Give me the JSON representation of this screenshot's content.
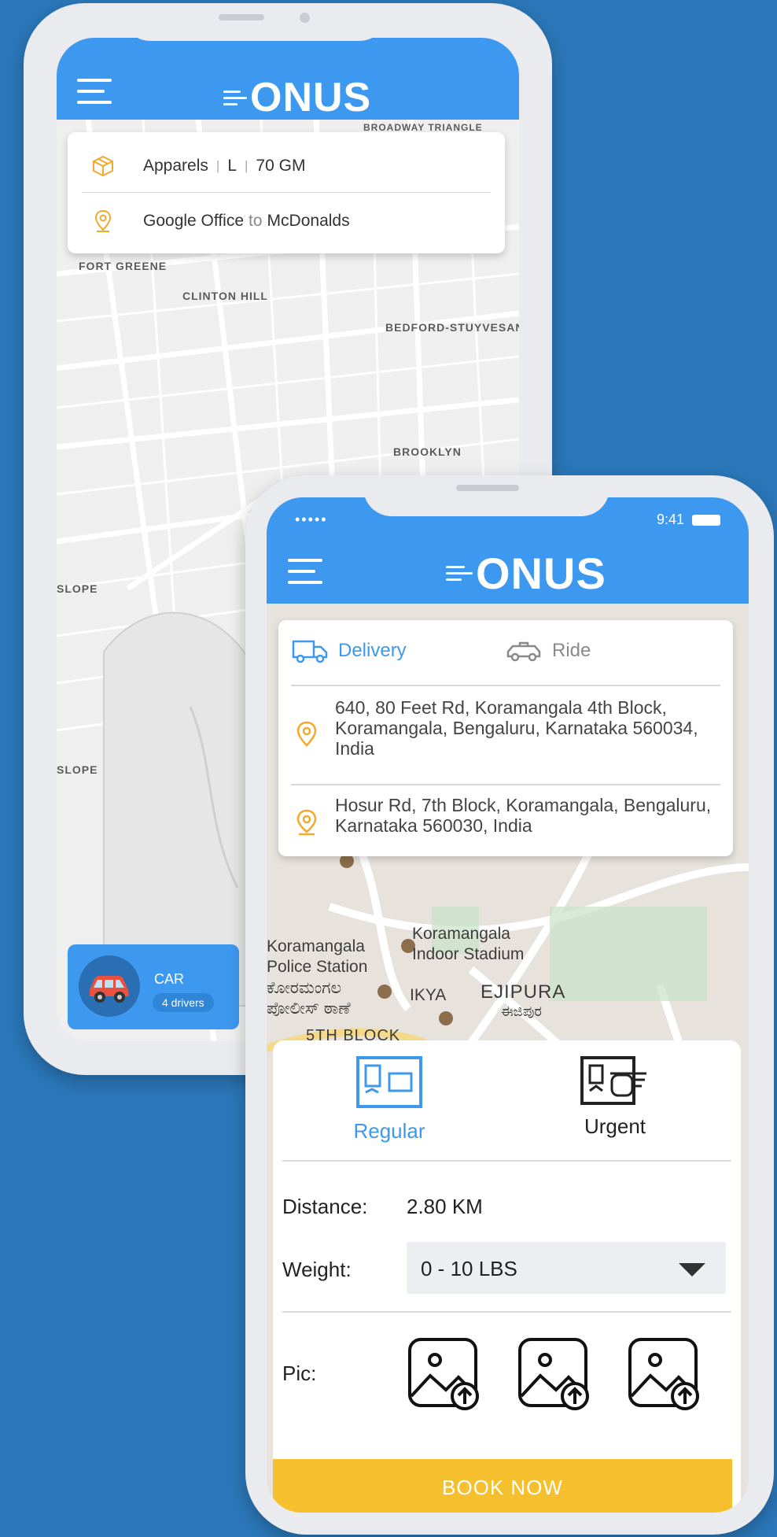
{
  "brand": {
    "logo_text": "ONUS",
    "primary": "#3d98ef",
    "accent": "#f6bf2e",
    "background": "#2b77b9"
  },
  "back_phone": {
    "item": {
      "category": "Apparels",
      "size": "L",
      "weight": "70 GM"
    },
    "route": {
      "from": "Google Office",
      "connector": "to",
      "to": "McDonalds"
    },
    "map_labels": [
      "BROADWAY TRIANGLE",
      "FORT GREENE",
      "CLINTON HILL",
      "BEDFORD-STUYVESAN",
      "BROOKLYN",
      "SLOPE",
      "SLOPE"
    ],
    "vehicle": {
      "name": "CAR",
      "drivers": "4 drivers"
    }
  },
  "front_phone": {
    "status": {
      "signal": "•••••",
      "time": "9:41"
    },
    "tabs": [
      {
        "label": "Delivery",
        "icon": "truck-icon",
        "active": true
      },
      {
        "label": "Ride",
        "icon": "taxi-icon",
        "active": false
      }
    ],
    "pickup_address": "640, 80 Feet Rd, Koramangala 4th Block, Koramangala, Bengaluru, Karnataka 560034, India",
    "drop_address": "Hosur Rd, 7th Block, Koramangala, Bengaluru, Karnataka 560030, India",
    "map_labels": {
      "stadium": "Koramangala\nIndoor Stadium",
      "police": "Koramangala\nPolice Station\nಕೋರಮಂಗಲ\nಪೋಲೀಸ್ ಠಾಣೆ",
      "ikya": "IKYA",
      "ejipura": "EJIPURA",
      "ejipura_kn": "ಈಜಿಪುರ",
      "block": "5TH BLOCK"
    },
    "service_types": [
      {
        "label": "Regular",
        "active": true
      },
      {
        "label": "Urgent",
        "active": false
      }
    ],
    "distance_label": "Distance:",
    "distance_value": "2.80 KM",
    "weight_label": "Weight:",
    "weight_value": "0 - 10 LBS",
    "pic_label": "Pic:",
    "book_label": "BOOK NOW"
  }
}
